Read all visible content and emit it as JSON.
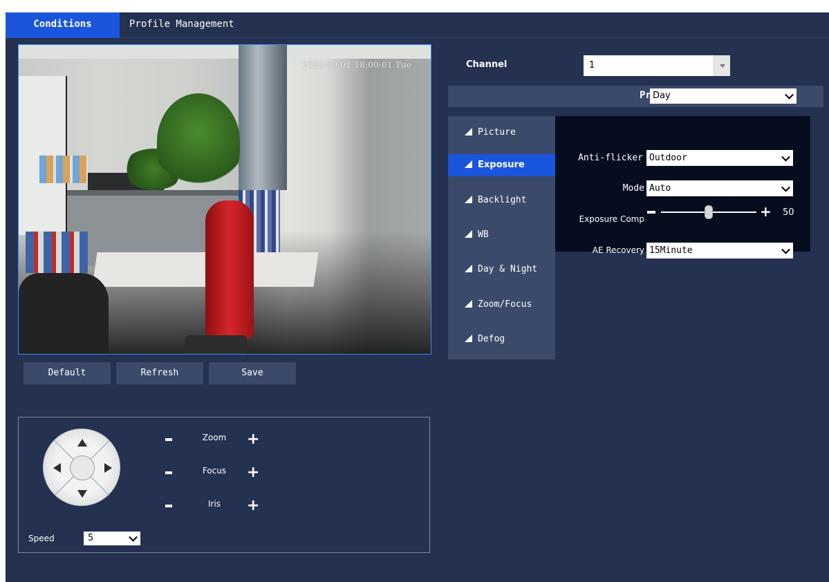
{
  "tabs": [
    {
      "label": "Conditions",
      "active": true
    },
    {
      "label": "Profile Management",
      "active": false
    }
  ],
  "video": {
    "osd_timestamp": "2021-09-01 18:00:01 Tue"
  },
  "buttons": {
    "default": "Default",
    "refresh": "Refresh",
    "save": "Save"
  },
  "ptz": {
    "zoom": "Zoom",
    "focus": "Focus",
    "iris": "Iris",
    "speed_label": "Speed",
    "speed_value": "5"
  },
  "channel": {
    "label": "Channel",
    "value": "1"
  },
  "profile": {
    "label": "Profile",
    "value": "Day"
  },
  "menu": {
    "items": [
      {
        "label": "Picture"
      },
      {
        "label": "Exposure",
        "active": true
      },
      {
        "label": "Backlight"
      },
      {
        "label": "WB"
      },
      {
        "label": "Day & Night"
      },
      {
        "label": "Zoom/Focus"
      },
      {
        "label": "Defog"
      }
    ]
  },
  "exposure": {
    "anti_flicker_label": "Anti-flicker",
    "anti_flicker_value": "Outdoor",
    "mode_label": "Mode",
    "mode_value": "Auto",
    "comp_label": "Exposure Comp",
    "comp_value": "50",
    "comp_fraction": 0.5,
    "ae_recovery_label": "AE Recovery",
    "ae_recovery_value": "15Minute"
  },
  "colors": {
    "accent": "#1a56db",
    "background": "#243150",
    "panel": "#3b4a6a"
  }
}
